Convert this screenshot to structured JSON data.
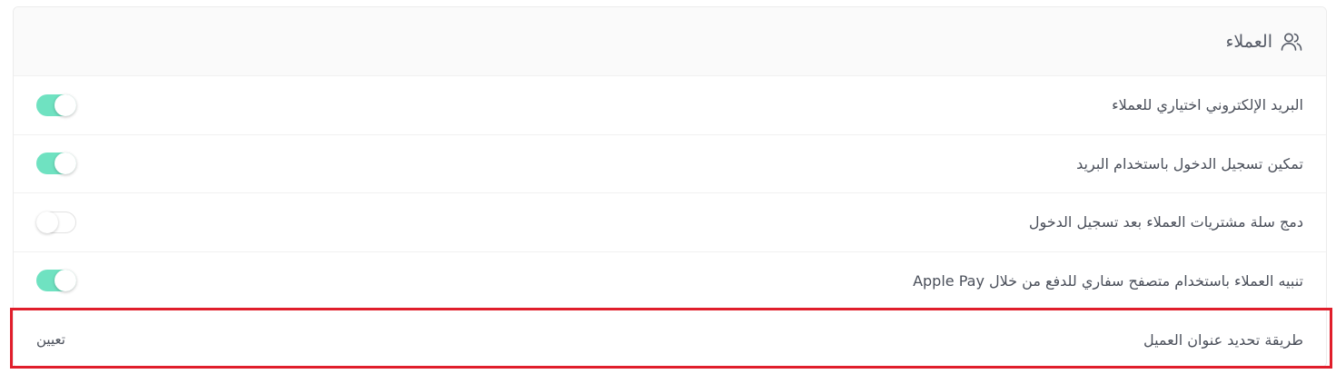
{
  "header": {
    "title": "العملاء",
    "icon": "users-icon"
  },
  "settings": [
    {
      "label": "البريد الإلكتروني اختياري للعملاء",
      "control": "toggle",
      "enabled": true
    },
    {
      "label": "تمكين تسجيل الدخول باستخدام البريد",
      "control": "toggle",
      "enabled": true
    },
    {
      "label": "دمج سلة مشتريات العملاء بعد تسجيل الدخول",
      "control": "toggle",
      "enabled": false
    },
    {
      "label": "تنبيه العملاء باستخدام متصفح سفاري للدفع من خلال Apple Pay",
      "control": "toggle",
      "enabled": true
    },
    {
      "label": "طريقة تحديد عنوان العميل",
      "control": "link",
      "value": "تعيين"
    }
  ],
  "colors": {
    "toggle_on": "#6fe2c1",
    "highlight_border": "#e01e2b"
  }
}
